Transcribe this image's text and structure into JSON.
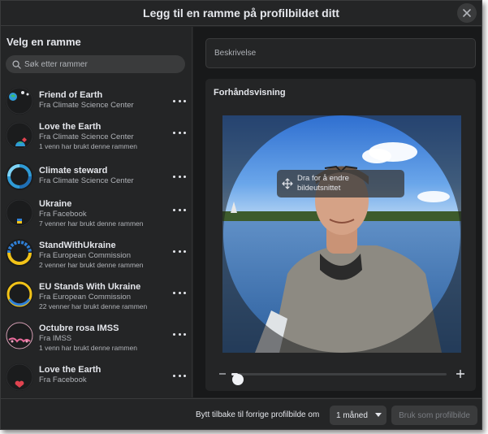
{
  "header": {
    "title": "Legg til en ramme på profilbildet ditt",
    "close_icon": "close-icon"
  },
  "left": {
    "title": "Velg en ramme",
    "search": {
      "placeholder": "Søk etter rammer",
      "value": ""
    },
    "frames": [
      {
        "name": "Friend of Earth",
        "source": "Fra Climate Science Center",
        "usage": ""
      },
      {
        "name": "Love the Earth",
        "source": "Fra Climate Science Center",
        "usage": "1 venn har brukt denne rammen"
      },
      {
        "name": "Climate steward",
        "source": "Fra Climate Science Center",
        "usage": ""
      },
      {
        "name": "Ukraine",
        "source": "Fra Facebook",
        "usage": "7 venner har brukt denne rammen"
      },
      {
        "name": "StandWithUkraine",
        "source": "Fra European Commission",
        "usage": "2 venner har brukt denne rammen"
      },
      {
        "name": "EU Stands With Ukraine",
        "source": "Fra European Commission",
        "usage": "22 venner har brukt denne rammen"
      },
      {
        "name": "Octubre rosa IMSS",
        "source": "Fra IMSS",
        "usage": "1 venn har brukt denne rammen"
      },
      {
        "name": "Love the Earth",
        "source": "Fra Facebook",
        "usage": ""
      }
    ]
  },
  "right": {
    "description": {
      "placeholder": "Beskrivelse",
      "value": ""
    },
    "preview": {
      "label": "Forhåndsvisning",
      "hint": "Dra for å endre bildeutsnittet",
      "zoom_fraction": 0.03
    }
  },
  "footer": {
    "revert_label": "Bytt tilbake til forrige profilbilde om",
    "duration": "1 måned",
    "use_button": "Bruk som profilbilde"
  },
  "colors": {
    "background": "#242526",
    "panel_dark": "#18191a",
    "text_primary": "#e4e6eb",
    "text_secondary": "#b0b3b8",
    "button_bg": "#3a3b3c"
  }
}
